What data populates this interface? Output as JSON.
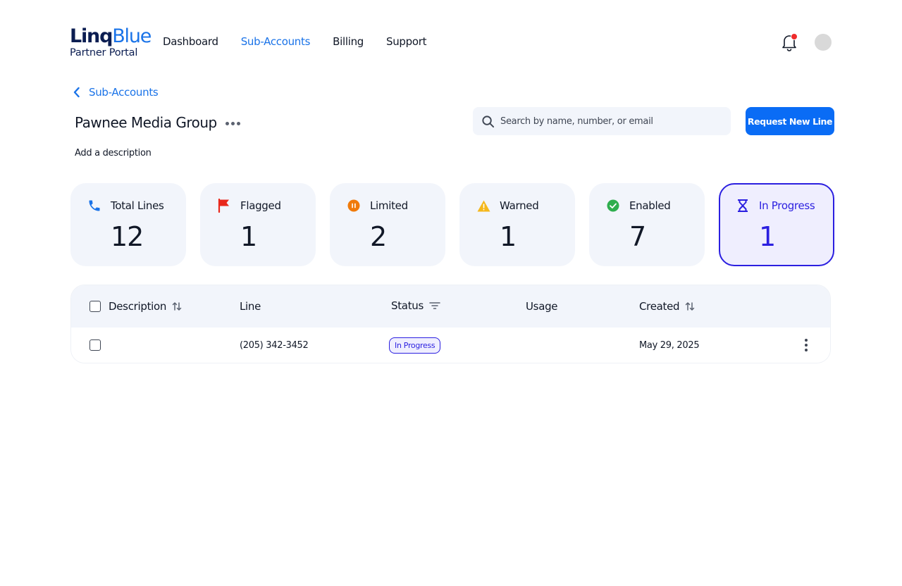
{
  "logo": {
    "word1": "Linq",
    "word2": "Blue",
    "subtitle": "Partner Portal"
  },
  "nav": {
    "items": [
      {
        "label": "Dashboard",
        "active": false
      },
      {
        "label": "Sub-Accounts",
        "active": true
      },
      {
        "label": "Billing",
        "active": false
      },
      {
        "label": "Support",
        "active": false
      }
    ]
  },
  "header": {
    "notification_icon": "bell-icon",
    "has_unread": true
  },
  "breadcrumb": {
    "back_label": "Sub-Accounts"
  },
  "page": {
    "title": "Pawnee Media Group",
    "add_description": "Add a description"
  },
  "search": {
    "placeholder": "Search by name, number, or email",
    "value": ""
  },
  "actions": {
    "request_new_line": "Request New Line"
  },
  "stats": [
    {
      "label": "Total Lines",
      "value": "12",
      "icon": "phone-icon",
      "color": "#1a73e8",
      "selected": false
    },
    {
      "label": "Flagged",
      "value": "1",
      "icon": "flag-icon",
      "color": "#e8281c",
      "selected": false
    },
    {
      "label": "Limited",
      "value": "2",
      "icon": "pause-circle-icon",
      "color": "#f07a0a",
      "selected": false
    },
    {
      "label": "Warned",
      "value": "1",
      "icon": "warning-icon",
      "color": "#f5b81c",
      "selected": false
    },
    {
      "label": "Enabled",
      "value": "7",
      "icon": "check-circle-icon",
      "color": "#2fae4e",
      "selected": false
    },
    {
      "label": "In Progress",
      "value": "1",
      "icon": "hourglass-icon",
      "color": "#2b1fe0",
      "selected": true
    }
  ],
  "table": {
    "columns": [
      {
        "label": "Description",
        "sortable": true
      },
      {
        "label": "Line",
        "sortable": false
      },
      {
        "label": "Status",
        "filterable": true
      },
      {
        "label": "Usage",
        "sortable": false
      },
      {
        "label": "Created",
        "sortable": true
      }
    ],
    "rows": [
      {
        "description": "",
        "line": "(205) 342-3452",
        "status": "In Progress",
        "usage": "",
        "created": "May 29, 2025"
      }
    ]
  }
}
